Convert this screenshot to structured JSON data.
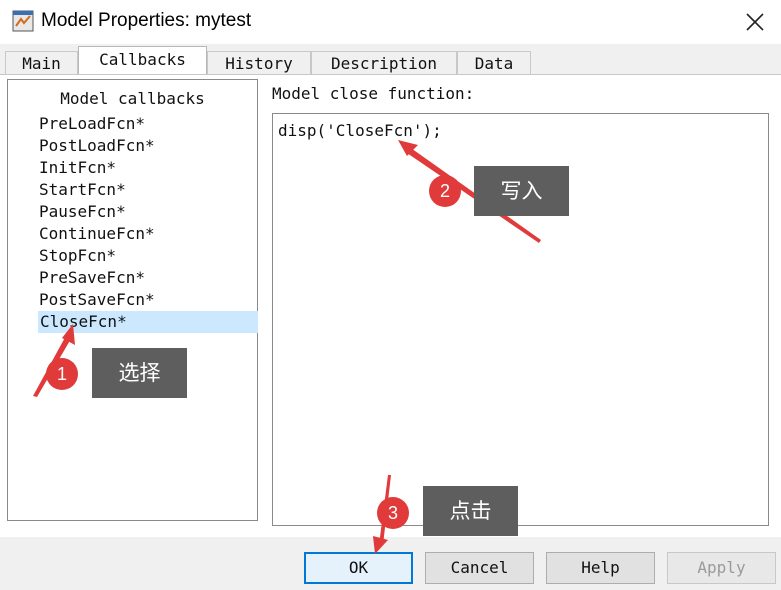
{
  "window": {
    "title": "Model Properties: mytest",
    "close_icon": "close-icon",
    "app_icon": "simulink-model-icon"
  },
  "tabs": [
    {
      "label": "Main"
    },
    {
      "label": "Callbacks",
      "active": true
    },
    {
      "label": "History"
    },
    {
      "label": "Description"
    },
    {
      "label": "Data"
    }
  ],
  "callbacks": {
    "title": "Model callbacks",
    "items": [
      "PreLoadFcn*",
      "PostLoadFcn*",
      "InitFcn*",
      "StartFcn*",
      "PauseFcn*",
      "ContinueFcn*",
      "StopFcn*",
      "PreSaveFcn*",
      "PostSaveFcn*",
      "CloseFcn*"
    ],
    "selected": "CloseFcn*"
  },
  "editor": {
    "label": "Model close function:",
    "content": "disp('CloseFcn');"
  },
  "buttons": {
    "ok": "OK",
    "cancel": "Cancel",
    "help": "Help",
    "apply": "Apply"
  },
  "annotations": [
    {
      "number": "1",
      "text": "选择"
    },
    {
      "number": "2",
      "text": "写入"
    },
    {
      "number": "3",
      "text": "点击"
    }
  ],
  "colors": {
    "selection": "#cce8ff",
    "annotation_red": "#e03a3a",
    "callout_bg": "#5e5e5e",
    "default_button_border": "#0078d7"
  }
}
